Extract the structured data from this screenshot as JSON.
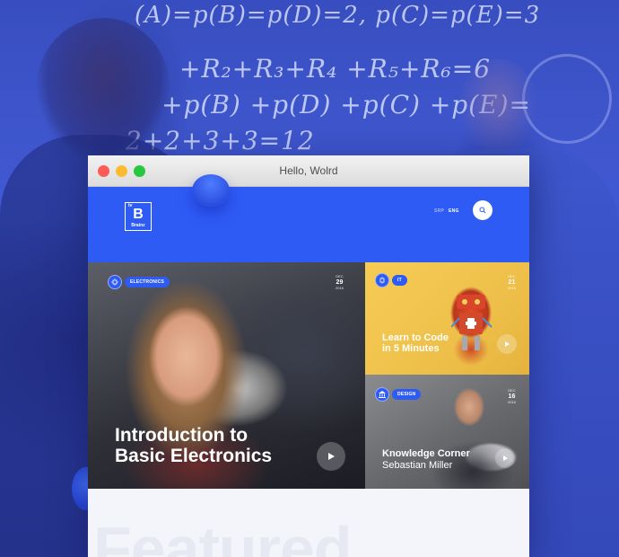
{
  "background": {
    "chalkboard_lines": [
      "(A)=p(B)=p(D)=2,   p(C)=p(E)=3",
      "+R₂+R₃+R₄ +R₅+R₆=6",
      "+p(B) +p(D) +p(C) +p(E)=",
      "2+2+3+3=12"
    ],
    "accent_color": "#3b52c9"
  },
  "window": {
    "title": "Hello, Wolrd"
  },
  "header": {
    "logo": {
      "tv": "tv",
      "letter": "B",
      "brand": "Brainz"
    },
    "languages": [
      "SRP",
      "ENG"
    ],
    "search_icon": "search-icon",
    "accent_color": "#2f5bf5"
  },
  "cards": {
    "main": {
      "category": "ELECTRONICS",
      "date": {
        "month": "DEC",
        "day": "29",
        "year": "2016"
      },
      "title_lines": [
        "Introduction to",
        "Basic Electronics"
      ]
    },
    "top_right": {
      "category": "IT",
      "date": {
        "month": "DEC",
        "day": "21",
        "year": "2016"
      },
      "title_lines": [
        "Learn to Code",
        "in 5 Minutes"
      ]
    },
    "bottom_right": {
      "category": "DESIGN",
      "date": {
        "month": "DEC",
        "day": "16",
        "year": "2016"
      },
      "title": "Knowledge Corner",
      "author": "Sebastian Miller"
    }
  },
  "section": {
    "heading": "Featured"
  }
}
